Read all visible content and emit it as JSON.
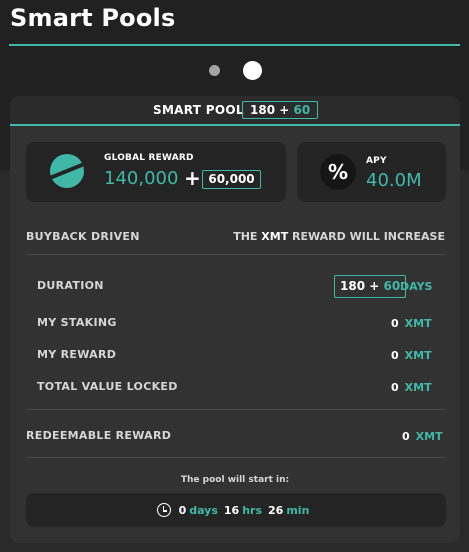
{
  "page": {
    "title": "Smart Pools"
  },
  "carousel": {
    "total_pages": 2,
    "active_page": 2
  },
  "pool": {
    "header_label": "SMART POOL",
    "duration_base": "180",
    "duration_plus": "+",
    "duration_bonus": "60"
  },
  "global_reward": {
    "label": "GLOBAL REWARD",
    "amount": "140,000",
    "plus": "+",
    "bonus": "60,000",
    "icon": "xmt-logo-icon"
  },
  "apy": {
    "label": "APY",
    "value": "40.0M",
    "icon_glyph": "%"
  },
  "buyback": {
    "label": "BUYBACK DRIVEN",
    "note_prefix": "THE",
    "note_token": "XMT",
    "note_suffix": "REWARD WILL INCREASE"
  },
  "stats": {
    "duration_label": "DURATION",
    "duration_base": "180",
    "duration_plus": "+",
    "duration_bonus": "60",
    "duration_unit": "DAYS",
    "staking_label": "MY STAKING",
    "staking_value": "0",
    "staking_unit": "XMT",
    "reward_label": "MY REWARD",
    "reward_value": "0",
    "reward_unit": "XMT",
    "tvl_label": "TOTAL VALUE LOCKED",
    "tvl_value": "0",
    "tvl_unit": "XMT"
  },
  "redeemable": {
    "label": "REDEEMABLE REWARD",
    "value": "0",
    "unit": "XMT"
  },
  "countdown": {
    "label": "The pool will start in:",
    "days": "0",
    "days_unit": "days",
    "hours": "16",
    "hours_unit": "hrs",
    "minutes": "26",
    "minutes_unit": "min",
    "icon": "clock-icon"
  },
  "colors": {
    "accent": "#3fb8a8",
    "background": "#212121",
    "card": "#323232",
    "tile": "#242424"
  }
}
